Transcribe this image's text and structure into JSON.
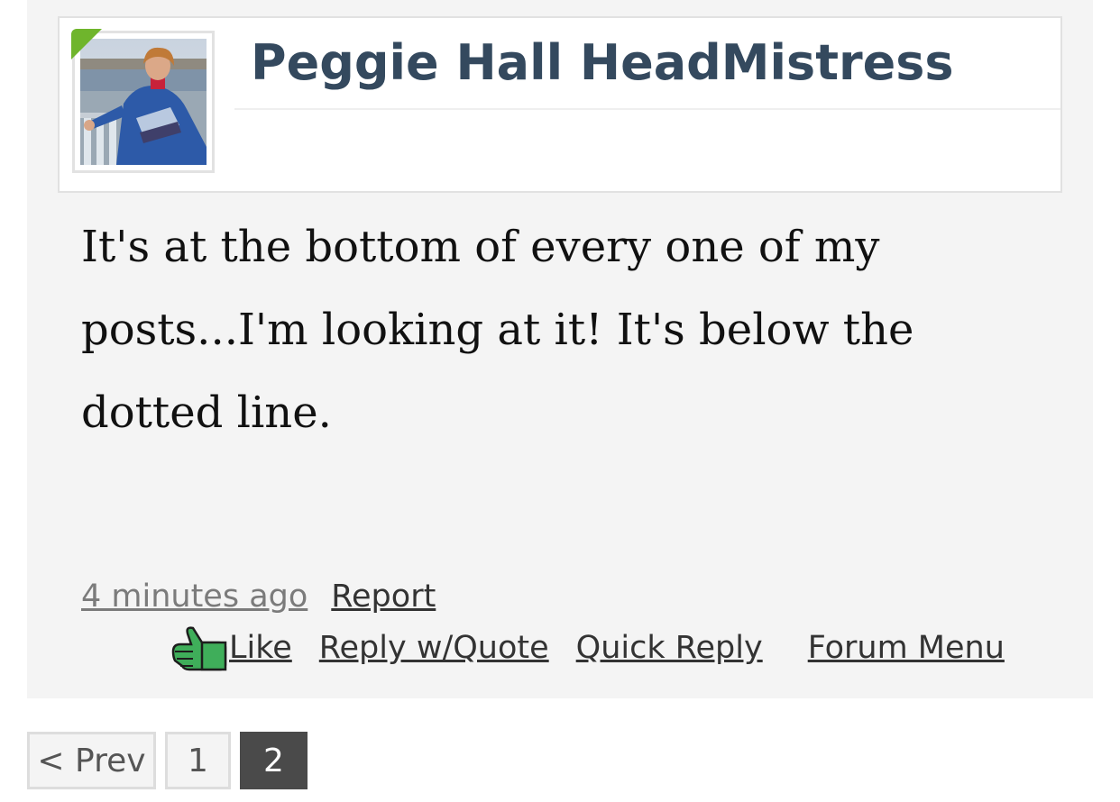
{
  "post": {
    "author": "Peggie Hall HeadMistress",
    "avatar_icon": "user-avatar-photo",
    "online_status_color": "#6fb52c",
    "body": "It's at the bottom of every one of my posts...I'm looking at it! It's below the dotted line.",
    "timestamp": "4 minutes ago",
    "report_label": "Report",
    "actions": {
      "like_icon": "thumbs-up-icon",
      "like_label": "Like",
      "reply_quote_label": "Reply w/Quote",
      "quick_reply_label": "Quick Reply",
      "forum_menu_label": "Forum Menu"
    }
  },
  "pagination": {
    "prev_label": "< Prev",
    "pages": [
      "1",
      "2"
    ],
    "current_page": "2"
  },
  "colors": {
    "username": "#34495e",
    "current_page_bg": "#4a4a4a",
    "post_bg": "#f4f4f4"
  }
}
